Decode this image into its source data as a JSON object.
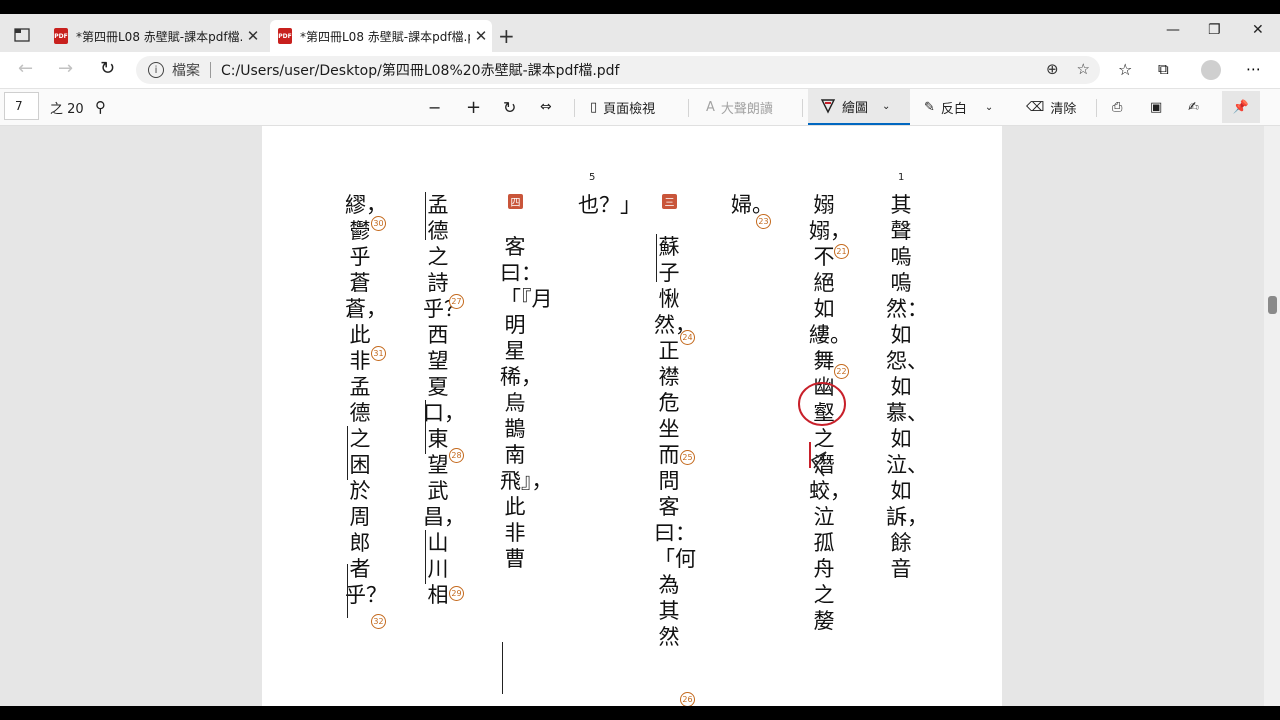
{
  "tabs": [
    {
      "title": "*第四冊L08 赤壁賦-課本pdf檔.pdf",
      "close": "✕"
    },
    {
      "title": "*第四冊L08 赤壁賦-課本pdf檔.pdf",
      "close": "✕"
    }
  ],
  "new_tab": "+",
  "window_controls": {
    "minimize": "—",
    "restore": "❐",
    "close": "✕"
  },
  "nav": {
    "back": "←",
    "forward": "→",
    "refresh": "↻"
  },
  "address": {
    "site_label": "檔案",
    "url": "C:/Users/user/Desktop/第四冊L08%20赤壁賦-課本pdf檔.pdf"
  },
  "pdf_toolbar": {
    "page_current": "7",
    "page_total": "之 20",
    "page_view": "頁面檢視",
    "read_aloud": "大聲朗讀",
    "draw": "繪圖",
    "highlight": "反白",
    "erase": "清除"
  },
  "document": {
    "line_numbers": [
      "1",
      "5"
    ],
    "markers": [
      "三",
      "四"
    ],
    "columns": [
      "其聲嗚嗚然：如怨、如慕、如泣、如訴，餘音",
      "嫋嫋，不絕如縷。舞幽壑之潛蛟，泣孤舟之嫠",
      "婦。",
      "蘇子愀然，正襟危坐而問客曰：「何為其然",
      "也？」",
      "客曰：「『月明星稀，烏鵲南飛』，此非曹",
      "孟德之詩乎？西望夏口，東望武昌，山川相",
      "繆，鬱乎蒼蒼，此非孟德之困於周郎者乎？"
    ],
    "footnotes": [
      "21",
      "22",
      "23",
      "24",
      "25",
      "26",
      "27",
      "28",
      "29",
      "30",
      "31",
      "32"
    ]
  },
  "colors": {
    "accent": "#0067c0",
    "marker": "#c9553a",
    "footnote": "#c46a1e",
    "ink": "#c8202a"
  }
}
